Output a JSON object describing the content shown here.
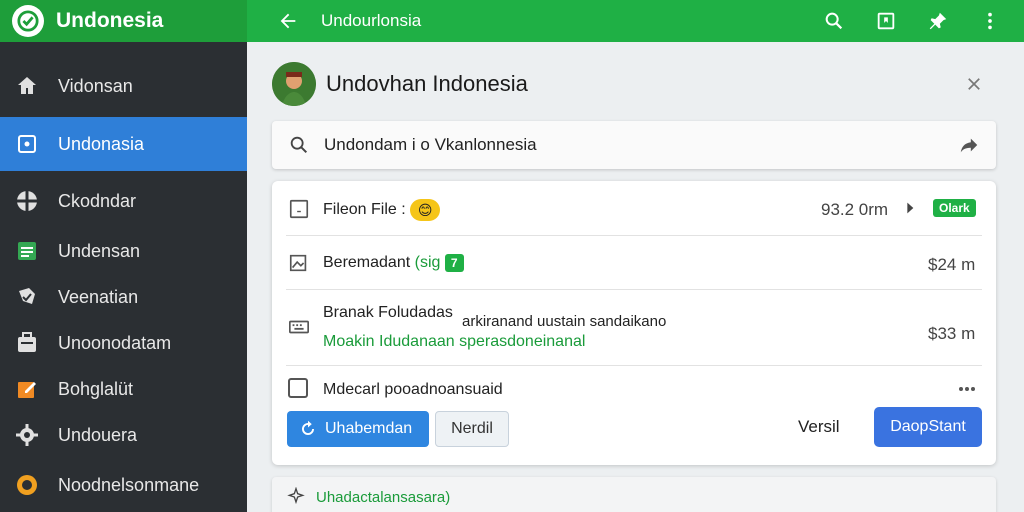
{
  "app": {
    "brand": "Undonesia",
    "accent": "#1fb045",
    "sidebar_bg": "#2b2f33",
    "active_bg": "#2f7fd8"
  },
  "sidebar": {
    "items": [
      {
        "label": "Vidonsan",
        "icon": "home-icon"
      },
      {
        "label": "Undonasia",
        "icon": "square-dot-icon",
        "active": true
      },
      {
        "label": "Ckodndar",
        "icon": "cross-circle-icon"
      },
      {
        "label": "Undensan",
        "icon": "document-icon"
      },
      {
        "label": "Veenatian",
        "icon": "check-badge-icon"
      },
      {
        "label": "Unoonodatam",
        "icon": "briefcase-icon"
      },
      {
        "label": "Bohglalüt",
        "icon": "edit-icon"
      },
      {
        "label": "Undouera",
        "icon": "gear-icon"
      },
      {
        "label": "Noodnelsonmane",
        "icon": "circle-icon"
      }
    ]
  },
  "topbar": {
    "title": "Undourlonsia",
    "actions": [
      "search-icon",
      "bookmark-icon",
      "pin-icon",
      "more-vert-icon"
    ]
  },
  "header": {
    "title": "Undovhan Indonesia"
  },
  "search": {
    "value": "Undondam i o Vkanlonnesia"
  },
  "list": {
    "row1": {
      "label": "Fileon File :",
      "value": "93.2 0rm",
      "badge": "Olark"
    },
    "row2": {
      "label": "Beremadant",
      "label_green": "(sig",
      "badge": "7",
      "value": "$24 m"
    },
    "row3": {
      "title": "Branak Foludadas",
      "subtitle": "arkiranand uustain sandaikano",
      "green_line": "Moakin Idudanaan sperasdoneinanal",
      "value": "$33 m"
    },
    "row4": {
      "label": "Mdecarl pooadnoansuaid"
    }
  },
  "buttons": {
    "primary_left": "Uhabemdan",
    "outline": "Nerdil",
    "text": "Versil",
    "primary_right": "DaopStant"
  },
  "footer": {
    "text": "Uhadactalansasara)"
  }
}
